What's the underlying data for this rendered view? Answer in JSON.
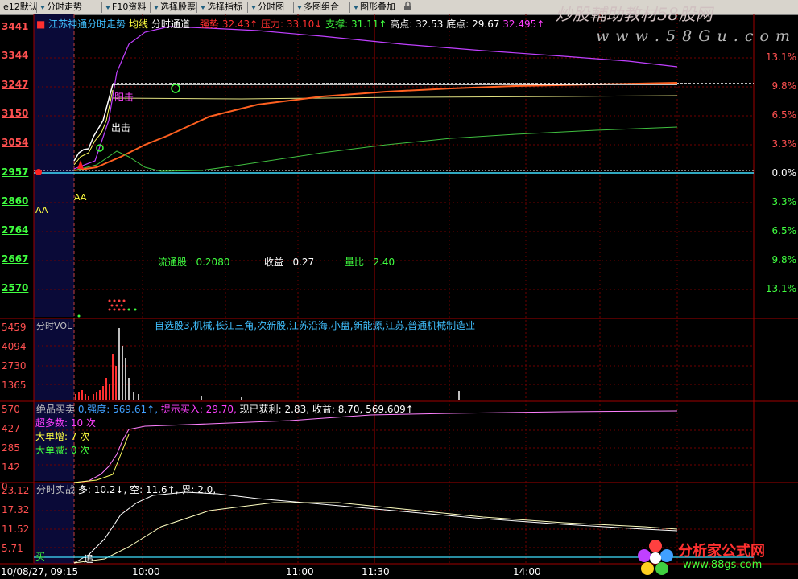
{
  "toolbar": {
    "items": [
      "e12默认",
      "分时走势",
      "F10资料",
      "选择股票",
      "选择指标",
      "分时图",
      "多图组合",
      "图形叠加"
    ]
  },
  "brand": {
    "title": "炒股輔助教材58股网",
    "url": "w w w . 5 8 G u . c o m"
  },
  "main": {
    "title": "江苏神通分时走势",
    "avg_label": "均线",
    "indicator": "分时通道",
    "items": [
      {
        "text": "强势 32.43↑",
        "color": "#ff3030"
      },
      {
        "text": "压力: 33.10↓",
        "color": "#ff3030"
      },
      {
        "text": "支撑: 31.11↑",
        "color": "#40ff40"
      },
      {
        "text": "高点: 32.53",
        "color": "#ffffff"
      },
      {
        "text": "底点: 29.67",
        "color": "#ffffff"
      },
      {
        "text": "32.495↑",
        "color": "#ff40ff"
      }
    ],
    "y_left": [
      "3441",
      "3344",
      "3247",
      "3150",
      "3054",
      "2957",
      "2860",
      "2764",
      "2667",
      "2570"
    ],
    "y_right": [
      "13.1%",
      "9.8%",
      "6.5%",
      "3.3%",
      "0.0%",
      "3.3%",
      "6.5%",
      "9.8%",
      "13.1%"
    ],
    "annotations": {
      "yangkou": "阳击",
      "chuji": "出击",
      "aa1": "AA",
      "aa2": "AA"
    },
    "stats": [
      {
        "label": "流通股",
        "value": "0.2080"
      },
      {
        "label": "收益",
        "value": "0.27"
      },
      {
        "label": "量比",
        "value": "2.40"
      }
    ],
    "concepts": "自选股3,机械,长江三角,次新股,江苏沿海,小盘,新能源,江苏,普通机械制造业"
  },
  "volume": {
    "title": "分时VOL",
    "y_left": [
      "5459",
      "4094",
      "2730",
      "1365"
    ]
  },
  "buysell": {
    "title": "绝品买卖",
    "items": [
      {
        "text": "0,强度: 569.61↑,",
        "color": "#40a0ff"
      },
      {
        "text": "提示买入: 29.70,",
        "color": "#ff40ff"
      },
      {
        "text": "现已获利: 2.83,",
        "color": "#ffffff"
      },
      {
        "text": "收益: 8.70,",
        "color": "#ffffff"
      },
      {
        "text": "569.609↑",
        "color": "#ffffff"
      }
    ],
    "y_left": [
      "570",
      "427",
      "285",
      "142",
      "0"
    ],
    "counts": [
      {
        "text": "超多数: 10 次",
        "color": "#ff40ff"
      },
      {
        "text": "大单增: 7 次",
        "color": "#ffff40"
      },
      {
        "text": "大单减: 0 次",
        "color": "#40ff40"
      }
    ]
  },
  "battle": {
    "title": "分时实战",
    "items": [
      {
        "text": "多: 10.2↓,",
        "color": "#ffffff"
      },
      {
        "text": "空: 11.6↑,",
        "color": "#ffffff"
      },
      {
        "text": "界: 2.0,",
        "color": "#ffffff"
      }
    ],
    "y_left": [
      "23.12",
      "17.32",
      "11.52",
      "5.71"
    ],
    "buy_label": "买",
    "chase_label": "追"
  },
  "time_axis": [
    "10/08/27, 09:15",
    "10:00",
    "11:00",
    "11:30",
    "14:00"
  ],
  "footer_logo": {
    "name": "分析家公式网",
    "url": "www.88gs.com"
  },
  "colors": {
    "price": "#ffffff",
    "avg": "#ffff60",
    "channel_top": "#c040ff",
    "ma_orange": "#ff6020",
    "ma_green": "#40c040",
    "ma_yellow": "#e0e080",
    "grid": "#800000"
  }
}
